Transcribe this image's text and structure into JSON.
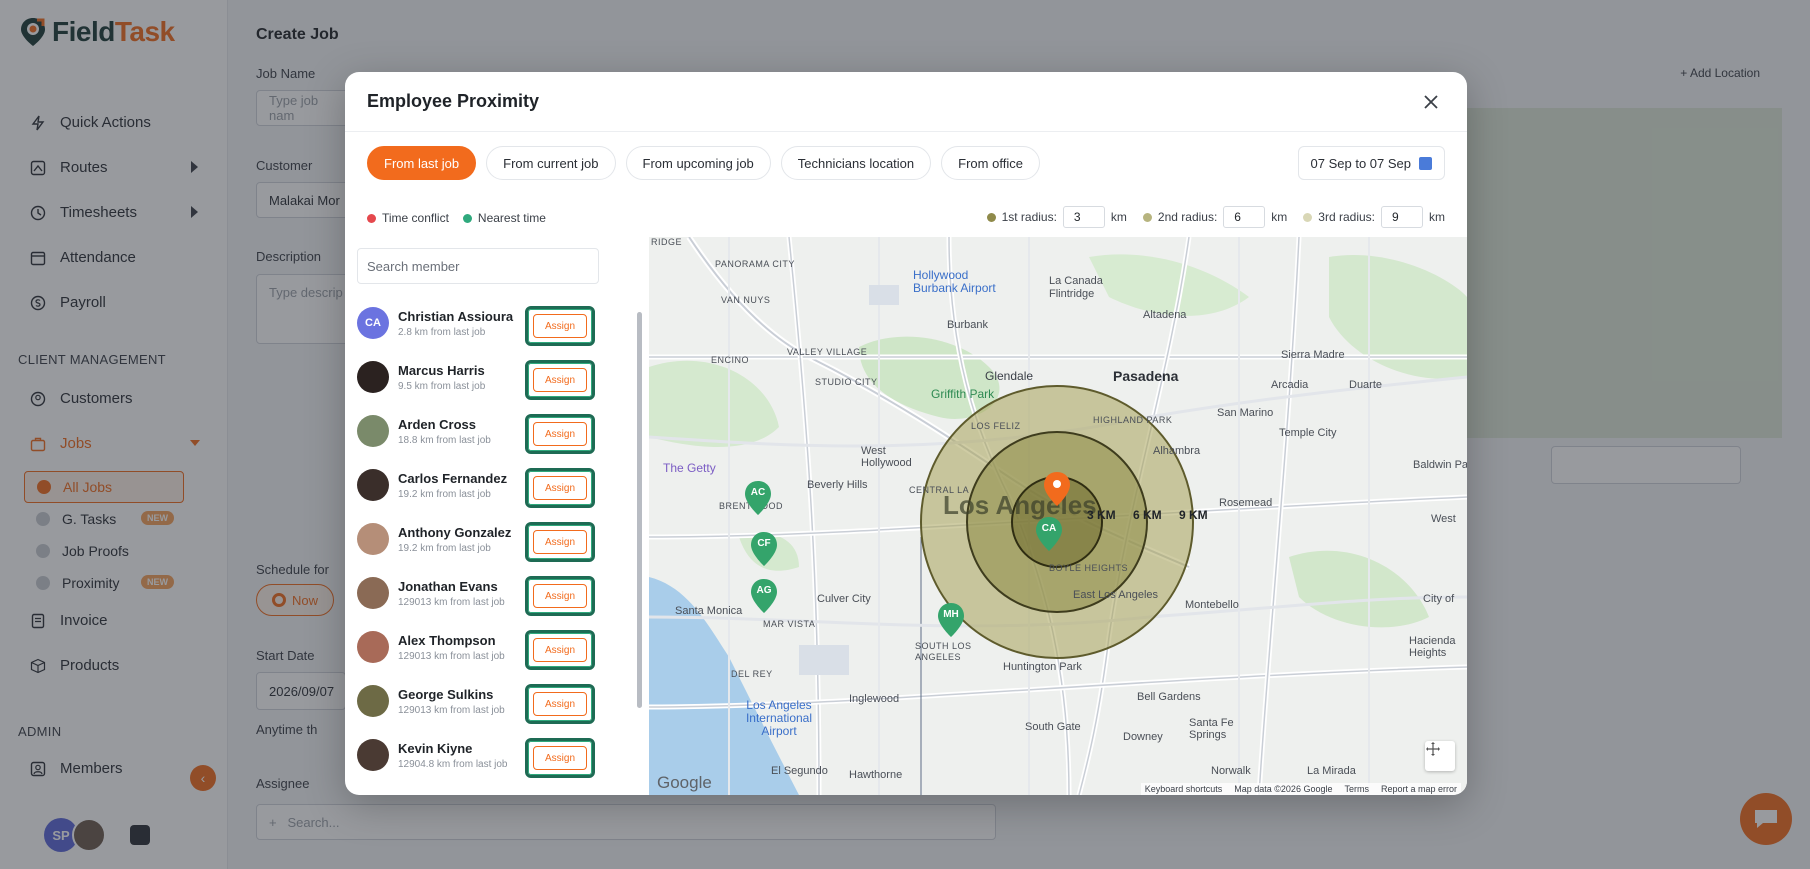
{
  "app": {
    "logo_text_a": "Field",
    "logo_text_b": "Task",
    "accent_color": "#f26b1d"
  },
  "sidebar": {
    "items": [
      {
        "label": "Quick Actions",
        "icon": "lightning-icon"
      },
      {
        "label": "Routes",
        "icon": "routes-icon"
      },
      {
        "label": "Timesheets",
        "icon": "clock-icon"
      },
      {
        "label": "Attendance",
        "icon": "calendar-icon"
      },
      {
        "label": "Payroll",
        "icon": "payroll-icon"
      }
    ],
    "client_section": "CLIENT MANAGEMENT",
    "client_items": [
      {
        "label": "Customers",
        "icon": "user-icon"
      },
      {
        "label": "Jobs",
        "icon": "briefcase-icon"
      }
    ],
    "job_sub_items": [
      {
        "label": "All Jobs",
        "badge": ""
      },
      {
        "label": "G. Tasks",
        "badge": "NEW"
      },
      {
        "label": "Job Proofs",
        "badge": ""
      },
      {
        "label": "Proximity",
        "badge": "NEW"
      }
    ],
    "more_items": [
      {
        "label": "Invoice",
        "icon": "invoice-icon"
      },
      {
        "label": "Products",
        "icon": "box-icon"
      }
    ],
    "admin_section": "ADMIN",
    "admin_items": [
      {
        "label": "Members",
        "icon": "members-icon"
      }
    ],
    "user_initials": "SP"
  },
  "page": {
    "title": "Create Job",
    "job_name_label": "Job Name",
    "job_name_placeholder": "Type job nam",
    "customer_label": "Customer",
    "customer_value": "Malakai Mor",
    "description_label": "Description",
    "description_placeholder": "Type descrip",
    "add_location": "Add Location",
    "schedule_label": "Schedule for",
    "now_label": "Now",
    "start_date_label": "Start Date",
    "start_date_value": "2026/09/07",
    "anytime_label": "Anytime th",
    "assignee_label": "Assignee",
    "assignee_placeholder": "Search..."
  },
  "modal": {
    "title": "Employee Proximity",
    "tabs": [
      {
        "label": "From last job",
        "active": true
      },
      {
        "label": "From current job",
        "active": false
      },
      {
        "label": "From upcoming job",
        "active": false
      },
      {
        "label": "Technicians location",
        "active": false
      },
      {
        "label": "From office",
        "active": false
      }
    ],
    "date_range": "07 Sep to 07 Sep",
    "legend": {
      "time_conflict": "Time conflict",
      "time_conflict_color": "#e5484d",
      "nearest_time": "Nearest time",
      "nearest_time_color": "#2fa97d"
    },
    "radius": {
      "first_label": "1st radius:",
      "first_value": "3",
      "second_label": "2nd radius:",
      "second_value": "6",
      "third_label": "3rd radius:",
      "third_value": "9",
      "unit": "km"
    },
    "search_placeholder": "Search member",
    "assign_label": "Assign",
    "members": [
      {
        "name": "Christian Assioura",
        "distance": "2.8 km from last job",
        "initials": "CA",
        "avatar_color": "#6b73e0"
      },
      {
        "name": "Marcus Harris",
        "distance": "9.5 km from last job",
        "initials": "",
        "avatar_color": "#2b2220"
      },
      {
        "name": "Arden Cross",
        "distance": "18.8 km from last job",
        "initials": "",
        "avatar_color": "#7a8a6a"
      },
      {
        "name": "Carlos Fernandez",
        "distance": "19.2 km from last job",
        "initials": "",
        "avatar_color": "#3a2e2a"
      },
      {
        "name": "Anthony Gonzalez",
        "distance": "19.2 km from last job",
        "initials": "",
        "avatar_color": "#b58e78"
      },
      {
        "name": "Jonathan Evans",
        "distance": "129013 km from last job",
        "initials": "",
        "avatar_color": "#8a6a55"
      },
      {
        "name": "Alex Thompson",
        "distance": "129013 km from last job",
        "initials": "",
        "avatar_color": "#a86a58"
      },
      {
        "name": "George Sulkins",
        "distance": "129013 km from last job",
        "initials": "",
        "avatar_color": "#6d6a45"
      },
      {
        "name": "Kevin Kiyne",
        "distance": "12904.8 km from last job",
        "initials": "",
        "avatar_color": "#4a3a33"
      }
    ],
    "map": {
      "ring_labels": [
        "3 KM",
        "6 KM",
        "9 KM"
      ],
      "pins": [
        "AC",
        "CF",
        "AG",
        "MH",
        "CA"
      ],
      "labels": {
        "ridge": "RIDGE",
        "panorama": "PANORAMA CITY",
        "van_nuys": "VAN NUYS",
        "hollywood_burbank": "Hollywood Burbank Airport",
        "la_canada": "La Canada Flintridge",
        "altadena": "Altadena",
        "burbank": "Burbank",
        "sierra_madre": "Sierra Madre",
        "valley_village": "VALLEY VILLAGE",
        "encino": "ENCINO",
        "studio_city": "STUDIO CITY",
        "glendale": "Glendale",
        "pasadena": "Pasadena",
        "griffith": "Griffith Park",
        "arcadia": "Arcadia",
        "duarte": "Duarte",
        "los_feliz": "LOS FELIZ",
        "highland": "HIGHLAND PARK",
        "san_marino": "San Marino",
        "temple_city": "Temple City",
        "west_hollywood": "West Hollywood",
        "the_getty": "The Getty",
        "beverly_hills": "Beverly Hills",
        "alhambra": "Alhambra",
        "baldwin_park": "Baldwin Pa",
        "brentwood": "BRENTWOOD",
        "central": "CENTRAL LA",
        "los_angeles": "Los Angeles",
        "rosemead": "Rosemead",
        "west_covina": "West",
        "boyle": "BOYLE HEIGHTS",
        "culver_city": "Culver City",
        "east_la": "East Los Angeles",
        "montebello": "Montebello",
        "city_of": "City of",
        "santa_monica": "Santa Monica",
        "mar_vista": "MAR VISTA",
        "south_la": "SOUTH LOS ANGELES",
        "huntington": "Huntington Park",
        "hacienda": "Hacienda Heights",
        "del_rey": "DEL REY",
        "bell_gardens": "Bell Gardens",
        "lax": "Los Angeles International Airport",
        "inglewood": "Inglewood",
        "south_gate": "South Gate",
        "downey": "Downey",
        "santa_fe": "Santa Fe Springs",
        "el_segundo": "El Segundo",
        "hawthorne": "Hawthorne",
        "norwalk": "Norwalk",
        "la_mirada": "La Mirada"
      },
      "google": "Google",
      "footer": [
        "Keyboard shortcuts",
        "Map data ©2026 Google",
        "Terms",
        "Report a map error"
      ]
    }
  }
}
